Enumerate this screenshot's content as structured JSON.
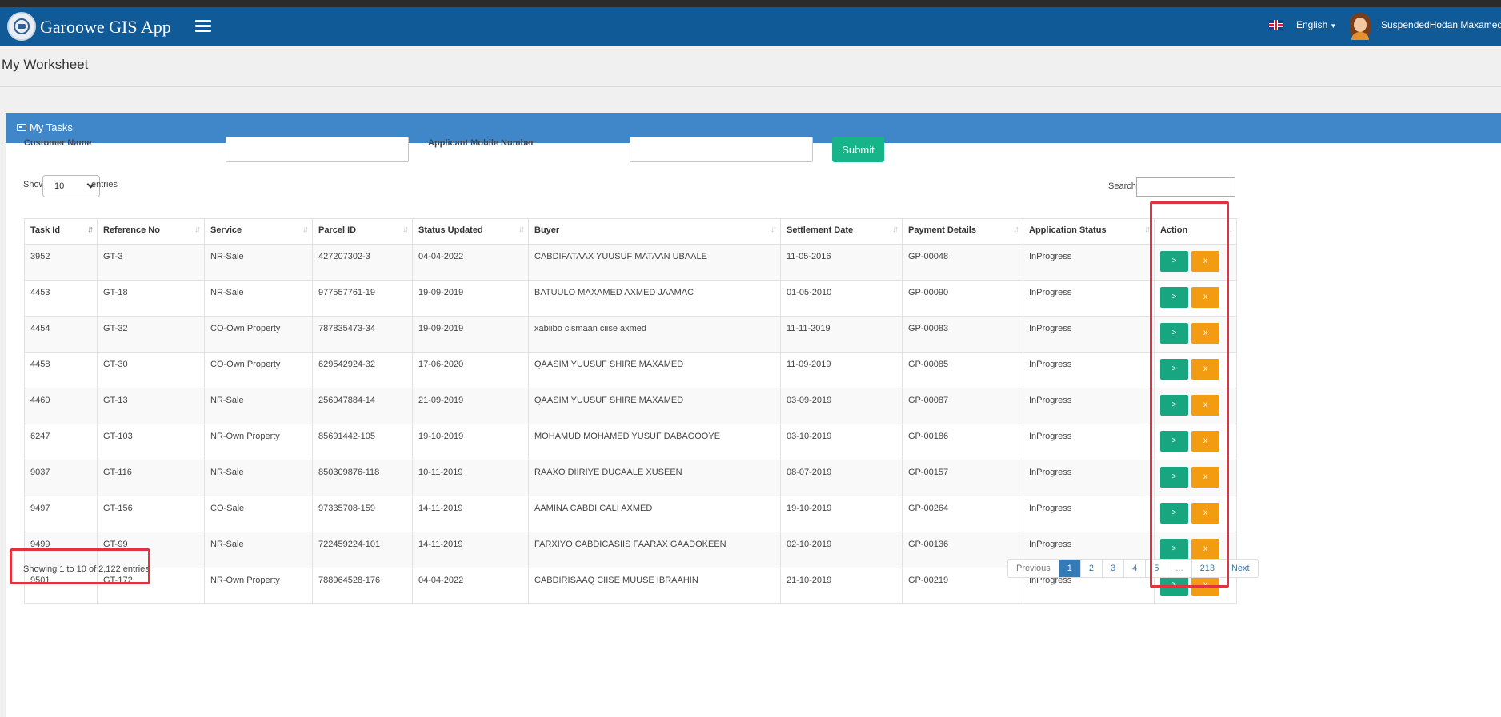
{
  "app": {
    "title": "Garoowe GIS App",
    "language": "English",
    "user": "SuspendedHodan Maxamed"
  },
  "page": {
    "title": "My Worksheet"
  },
  "panel": {
    "title": "My Tasks"
  },
  "filters": {
    "customer_name_label": "Customer Name",
    "customer_name_value": "",
    "mobile_label": "Applicant Mobile Number",
    "mobile_value": "",
    "submit_label": "Submit"
  },
  "table_controls": {
    "show_label": "Show",
    "entries_label": "entries",
    "page_size": "10",
    "search_label": "Search:",
    "search_value": ""
  },
  "table": {
    "columns": [
      "Task Id",
      "Reference No",
      "Service",
      "Parcel ID",
      "Status Updated",
      "Buyer",
      "Settlement Date",
      "Payment Details",
      "Application Status",
      "Action"
    ],
    "action_go_label": ">",
    "action_cancel_label": "x",
    "rows": [
      {
        "task_id": "3952",
        "ref": "GT-3",
        "service": "NR-Sale",
        "parcel": "427207302-3",
        "updated": "04-04-2022",
        "buyer": "CABDIFATAAX YUUSUF MATAAN UBAALE",
        "settlement": "11-05-2016",
        "payment": "GP-00048",
        "status": "InProgress"
      },
      {
        "task_id": "4453",
        "ref": "GT-18",
        "service": "NR-Sale",
        "parcel": "977557761-19",
        "updated": "19-09-2019",
        "buyer": "BATUULO MAXAMED AXMED JAAMAC",
        "settlement": "01-05-2010",
        "payment": "GP-00090",
        "status": "InProgress"
      },
      {
        "task_id": "4454",
        "ref": "GT-32",
        "service": "CO-Own Property",
        "parcel": "787835473-34",
        "updated": "19-09-2019",
        "buyer": "xabiibo cismaan ciise axmed",
        "settlement": "11-11-2019",
        "payment": "GP-00083",
        "status": "InProgress"
      },
      {
        "task_id": "4458",
        "ref": "GT-30",
        "service": "CO-Own Property",
        "parcel": "629542924-32",
        "updated": "17-06-2020",
        "buyer": "QAASIM YUUSUF SHIRE MAXAMED",
        "settlement": "11-09-2019",
        "payment": "GP-00085",
        "status": "InProgress"
      },
      {
        "task_id": "4460",
        "ref": "GT-13",
        "service": "NR-Sale",
        "parcel": "256047884-14",
        "updated": "21-09-2019",
        "buyer": "QAASIM YUUSUF SHIRE MAXAMED",
        "settlement": "03-09-2019",
        "payment": "GP-00087",
        "status": "InProgress"
      },
      {
        "task_id": "6247",
        "ref": "GT-103",
        "service": "NR-Own Property",
        "parcel": "85691442-105",
        "updated": "19-10-2019",
        "buyer": "MOHAMUD MOHAMED YUSUF DABAGOOYE",
        "settlement": "03-10-2019",
        "payment": "GP-00186",
        "status": "InProgress"
      },
      {
        "task_id": "9037",
        "ref": "GT-116",
        "service": "NR-Sale",
        "parcel": "850309876-118",
        "updated": "10-11-2019",
        "buyer": "RAAXO DIIRIYE DUCAALE XUSEEN",
        "settlement": "08-07-2019",
        "payment": "GP-00157",
        "status": "InProgress"
      },
      {
        "task_id": "9497",
        "ref": "GT-156",
        "service": "CO-Sale",
        "parcel": "97335708-159",
        "updated": "14-11-2019",
        "buyer": "AAMINA CABDI CALI AXMED",
        "settlement": "19-10-2019",
        "payment": "GP-00264",
        "status": "InProgress"
      },
      {
        "task_id": "9499",
        "ref": "GT-99",
        "service": "NR-Sale",
        "parcel": "722459224-101",
        "updated": "14-11-2019",
        "buyer": "FARXIYO CABDICASIIS FAARAX GAADOKEEN",
        "settlement": "02-10-2019",
        "payment": "GP-00136",
        "status": "InProgress"
      },
      {
        "task_id": "9501",
        "ref": "GT-172",
        "service": "NR-Own Property",
        "parcel": "788964528-176",
        "updated": "04-04-2022",
        "buyer": "CABDIRISAAQ CIISE MUUSE IBRAAHIN",
        "settlement": "21-10-2019",
        "payment": "GP-00219",
        "status": "InProgress"
      }
    ]
  },
  "footer": {
    "info": "Showing 1 to 10 of 2,122 entries",
    "pagination": [
      "Previous",
      "1",
      "2",
      "3",
      "4",
      "5",
      "...",
      "213",
      "Next"
    ],
    "active_page": "1"
  },
  "colors": {
    "navbar": "#0f5a97",
    "panel_heading": "#3f87c8",
    "submit": "#17b48a",
    "action_go": "#17a680",
    "action_cancel": "#f39c12",
    "highlight": "#e0323f"
  }
}
